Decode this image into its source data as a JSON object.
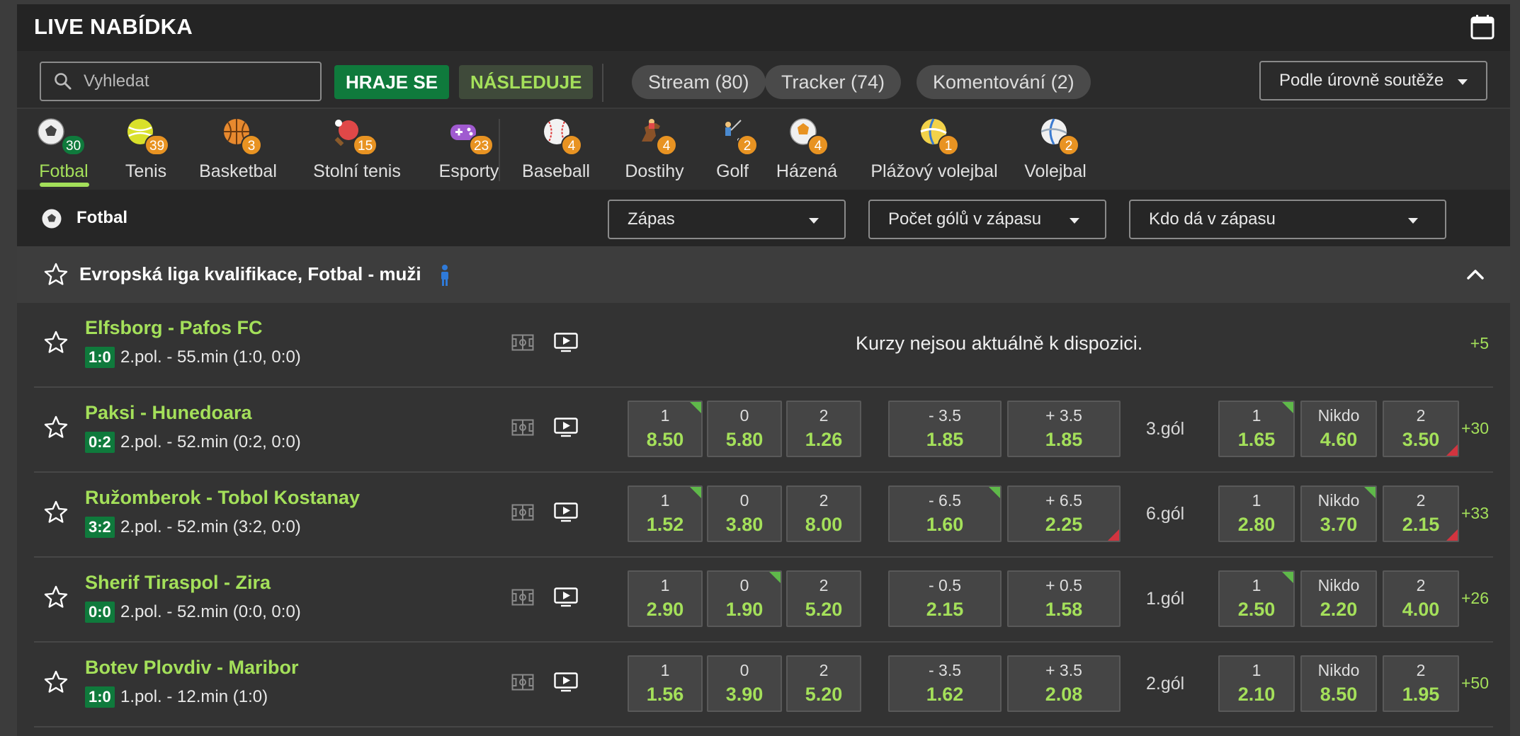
{
  "header": {
    "title": "LIVE NABÍDKA"
  },
  "filters": {
    "search_placeholder": "Vyhledat",
    "playing": "HRAJE SE",
    "following": "NÁSLEDUJE",
    "stream": "Stream (80)",
    "tracker": "Tracker (74)",
    "commentary": "Komentování (2)",
    "sort": "Podle úrovně soutěže"
  },
  "sports": [
    {
      "label": "Fotbal",
      "count": "30",
      "icon": "soccer-ball-icon"
    },
    {
      "label": "Tenis",
      "count": "39",
      "icon": "tennis-ball-icon"
    },
    {
      "label": "Basketbal",
      "count": "3",
      "icon": "basketball-icon"
    },
    {
      "label": "Stolní tenis",
      "count": "15",
      "icon": "ping-pong-icon"
    },
    {
      "label": "Esporty",
      "count": "23",
      "icon": "gamepad-icon"
    },
    {
      "label": "Baseball",
      "count": "4",
      "icon": "baseball-icon"
    },
    {
      "label": "Dostihy",
      "count": "4",
      "icon": "horse-racing-icon"
    },
    {
      "label": "Golf",
      "count": "2",
      "icon": "golf-icon"
    },
    {
      "label": "Házená",
      "count": "4",
      "icon": "handball-icon"
    },
    {
      "label": "Plážový volejbal",
      "count": "1",
      "icon": "beach-volleyball-icon"
    },
    {
      "label": "Volejbal",
      "count": "2",
      "icon": "volleyball-icon"
    }
  ],
  "market_bar": {
    "sport": "Fotbal",
    "market1": "Zápas",
    "market2": "Počet gólů v zápasu",
    "market3": "Kdo dá v zápasu"
  },
  "league": {
    "name": "Evropská liga kvalifikace, Fotbal - muži"
  },
  "matches": [
    {
      "teams": "Elfsborg - Pafos FC",
      "score": "1:0",
      "time": "2.pol. - 55.min (1:0, 0:0)",
      "unavailable": "Kurzy nejsou aktuálně k dispozici.",
      "more": "+5"
    },
    {
      "teams": "Paksi - Hunedoara",
      "score": "0:2",
      "time": "2.pol. - 52.min (0:2, 0:0)",
      "o1": "8.50",
      "o0": "5.80",
      "o2": "1.26",
      "u_lbl": "- 3.5",
      "u_val": "1.85",
      "ov_lbl": "+ 3.5",
      "ov_val": "1.85",
      "goal": "3.gól",
      "g1": "1.65",
      "gn": "4.60",
      "g2": "3.50",
      "more": "+30"
    },
    {
      "teams": "Ružomberok - Tobol Kostanay",
      "score": "3:2",
      "time": "2.pol. - 52.min (3:2, 0:0)",
      "o1": "1.52",
      "o0": "3.80",
      "o2": "8.00",
      "u_lbl": "- 6.5",
      "u_val": "1.60",
      "ov_lbl": "+ 6.5",
      "ov_val": "2.25",
      "goal": "6.gól",
      "g1": "2.80",
      "gn": "3.70",
      "g2": "2.15",
      "more": "+33"
    },
    {
      "teams": "Sherif Tiraspol - Zira",
      "score": "0:0",
      "time": "2.pol. - 52.min (0:0, 0:0)",
      "o1": "2.90",
      "o0": "1.90",
      "o2": "5.20",
      "u_lbl": "- 0.5",
      "u_val": "2.15",
      "ov_lbl": "+ 0.5",
      "ov_val": "1.58",
      "goal": "1.gól",
      "g1": "2.50",
      "gn": "2.20",
      "g2": "4.00",
      "more": "+26"
    },
    {
      "teams": "Botev Plovdiv - Maribor",
      "score": "1:0",
      "time": "1.pol. - 12.min (1:0)",
      "o1": "1.56",
      "o0": "3.90",
      "o2": "5.20",
      "u_lbl": "- 3.5",
      "u_val": "1.62",
      "ov_lbl": "+ 3.5",
      "ov_val": "2.08",
      "goal": "2.gól",
      "g1": "2.10",
      "gn": "8.50",
      "g2": "1.95",
      "more": "+50"
    }
  ],
  "odds_labels": {
    "home": "1",
    "draw": "0",
    "away": "2",
    "nobody": "Nikdo"
  },
  "colors": {
    "accent_green": "#a4e05a",
    "brand_green": "#0f7a3c",
    "badge_orange": "#e89322",
    "odds_up": "#5fb94a",
    "odds_down": "#d2343f"
  }
}
